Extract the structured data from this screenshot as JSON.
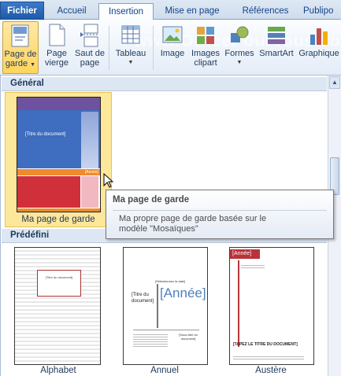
{
  "tabs": {
    "file": "Fichier",
    "home": "Accueil",
    "insert": "Insertion",
    "layout": "Mise en page",
    "references": "Références",
    "mailings": "Publipo"
  },
  "watermark": "www.OfficePourTous.com",
  "ribbon": {
    "cover_page": {
      "line1": "Page de",
      "line2": "garde"
    },
    "blank_page": {
      "line1": "Page",
      "line2": "vierge"
    },
    "page_break": {
      "line1": "Saut de",
      "line2": "page"
    },
    "table": {
      "line1": "Tableau"
    },
    "image": {
      "line1": "Image"
    },
    "clipart": {
      "line1": "Images",
      "line2": "clipart"
    },
    "shapes": {
      "line1": "Formes"
    },
    "smartart": {
      "line1": "SmartArt"
    },
    "chart": {
      "line1": "Graphique"
    }
  },
  "gallery": {
    "general_header": "Général",
    "predefined_header": "Prédéfini",
    "custom_item": {
      "caption": "Ma page de garde",
      "thumb_title": "[Titre du document]",
      "thumb_year": "[Année]"
    },
    "items": [
      {
        "caption": "Alphabet",
        "thumb_title": "[Titre du document]"
      },
      {
        "caption": "Annuel",
        "thumb_title": "[Titre du document]",
        "thumb_year": "[Année]",
        "thumb_date": "[Sélectionnez la date]",
        "thumb_doc": "[Sous-titre du document]"
      },
      {
        "caption": "Austère",
        "thumb_year": "[Année]",
        "thumb_title": "[TAPEZ LE TITRE DU DOCUMENT]"
      }
    ]
  },
  "tooltip": {
    "title": "Ma page de garde",
    "body_line1": "Ma propre page de garde basée sur le",
    "body_line2": "modèle \"Mosaïques\""
  },
  "colors": {
    "mosaic_top": "#6e52a0",
    "mosaic_mid": "#3f6dbf",
    "mosaic_orange": "#f08a2c",
    "mosaic_red": "#d0303a",
    "austere_accent": "#b8343a"
  }
}
